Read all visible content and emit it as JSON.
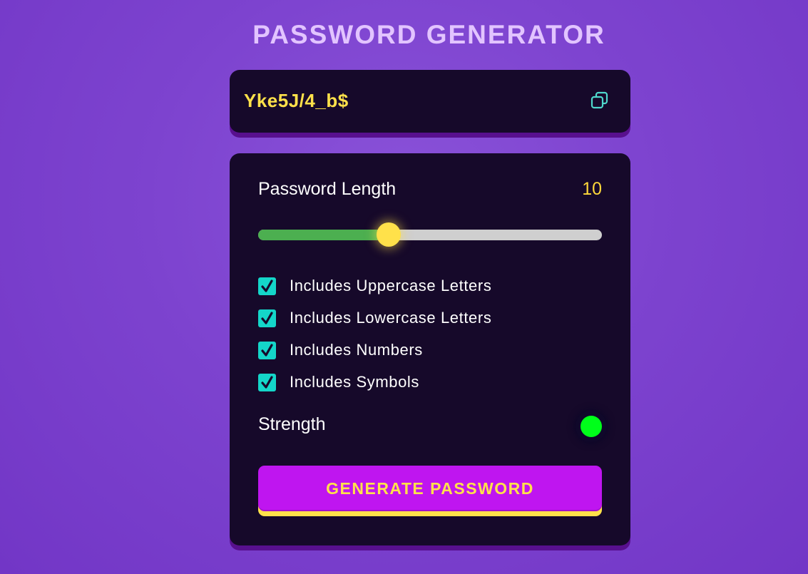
{
  "app": {
    "title": "PASSWORD GENERATOR"
  },
  "output": {
    "password": "Yke5J/4_b$",
    "copy_icon": "copy-icon"
  },
  "length": {
    "label": "Password Length",
    "value": "10",
    "slider_fraction": 0.38
  },
  "options": [
    {
      "label": "Includes Uppercase Letters",
      "checked": true
    },
    {
      "label": "Includes Lowercase Letters",
      "checked": true
    },
    {
      "label": "Includes Numbers",
      "checked": true
    },
    {
      "label": "Includes Symbols",
      "checked": true
    }
  ],
  "strength": {
    "label": "Strength",
    "indicator_color": "#00ff1a"
  },
  "generate": {
    "label": "GENERATE PASSWORD"
  },
  "colors": {
    "accent_yellow": "#ffe14a",
    "checkbox_teal": "#14d6c9",
    "button_magenta": "#bf15f0",
    "slider_green": "#4caf50",
    "card_bg": "#16092a"
  }
}
